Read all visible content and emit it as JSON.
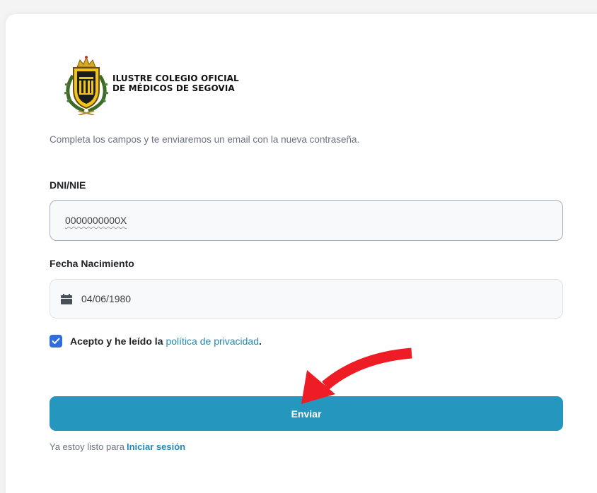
{
  "org": {
    "name_line1": "ILUSTRE COLEGIO OFICIAL",
    "name_line2": "DE MÉDICOS DE SEGOVIA",
    "logo_icon": "crest-icon"
  },
  "form": {
    "intro": "Completa los campos y te enviaremos un email con la nueva contraseña.",
    "dni_label": "DNI/NIE",
    "dni_value": "0000000000X",
    "birth_label": "Fecha Nacimiento",
    "birth_value": "04/06/1980",
    "calendar_icon": "calendar-icon",
    "consent_checked": true,
    "consent_text": "Acepto y he leído la",
    "consent_link": "política de privacidad",
    "consent_period": ".",
    "submit_label": "Enviar"
  },
  "footer": {
    "prefix": "Ya estoy listo para",
    "login_link": "Iniciar sesión"
  },
  "annotation": {
    "arrow_icon": "red-curved-arrow-icon"
  },
  "colors": {
    "primary": "#2596be",
    "link": "#1e8bb8",
    "checkbox": "#2e6cdf",
    "arrow": "#ee1c24"
  }
}
